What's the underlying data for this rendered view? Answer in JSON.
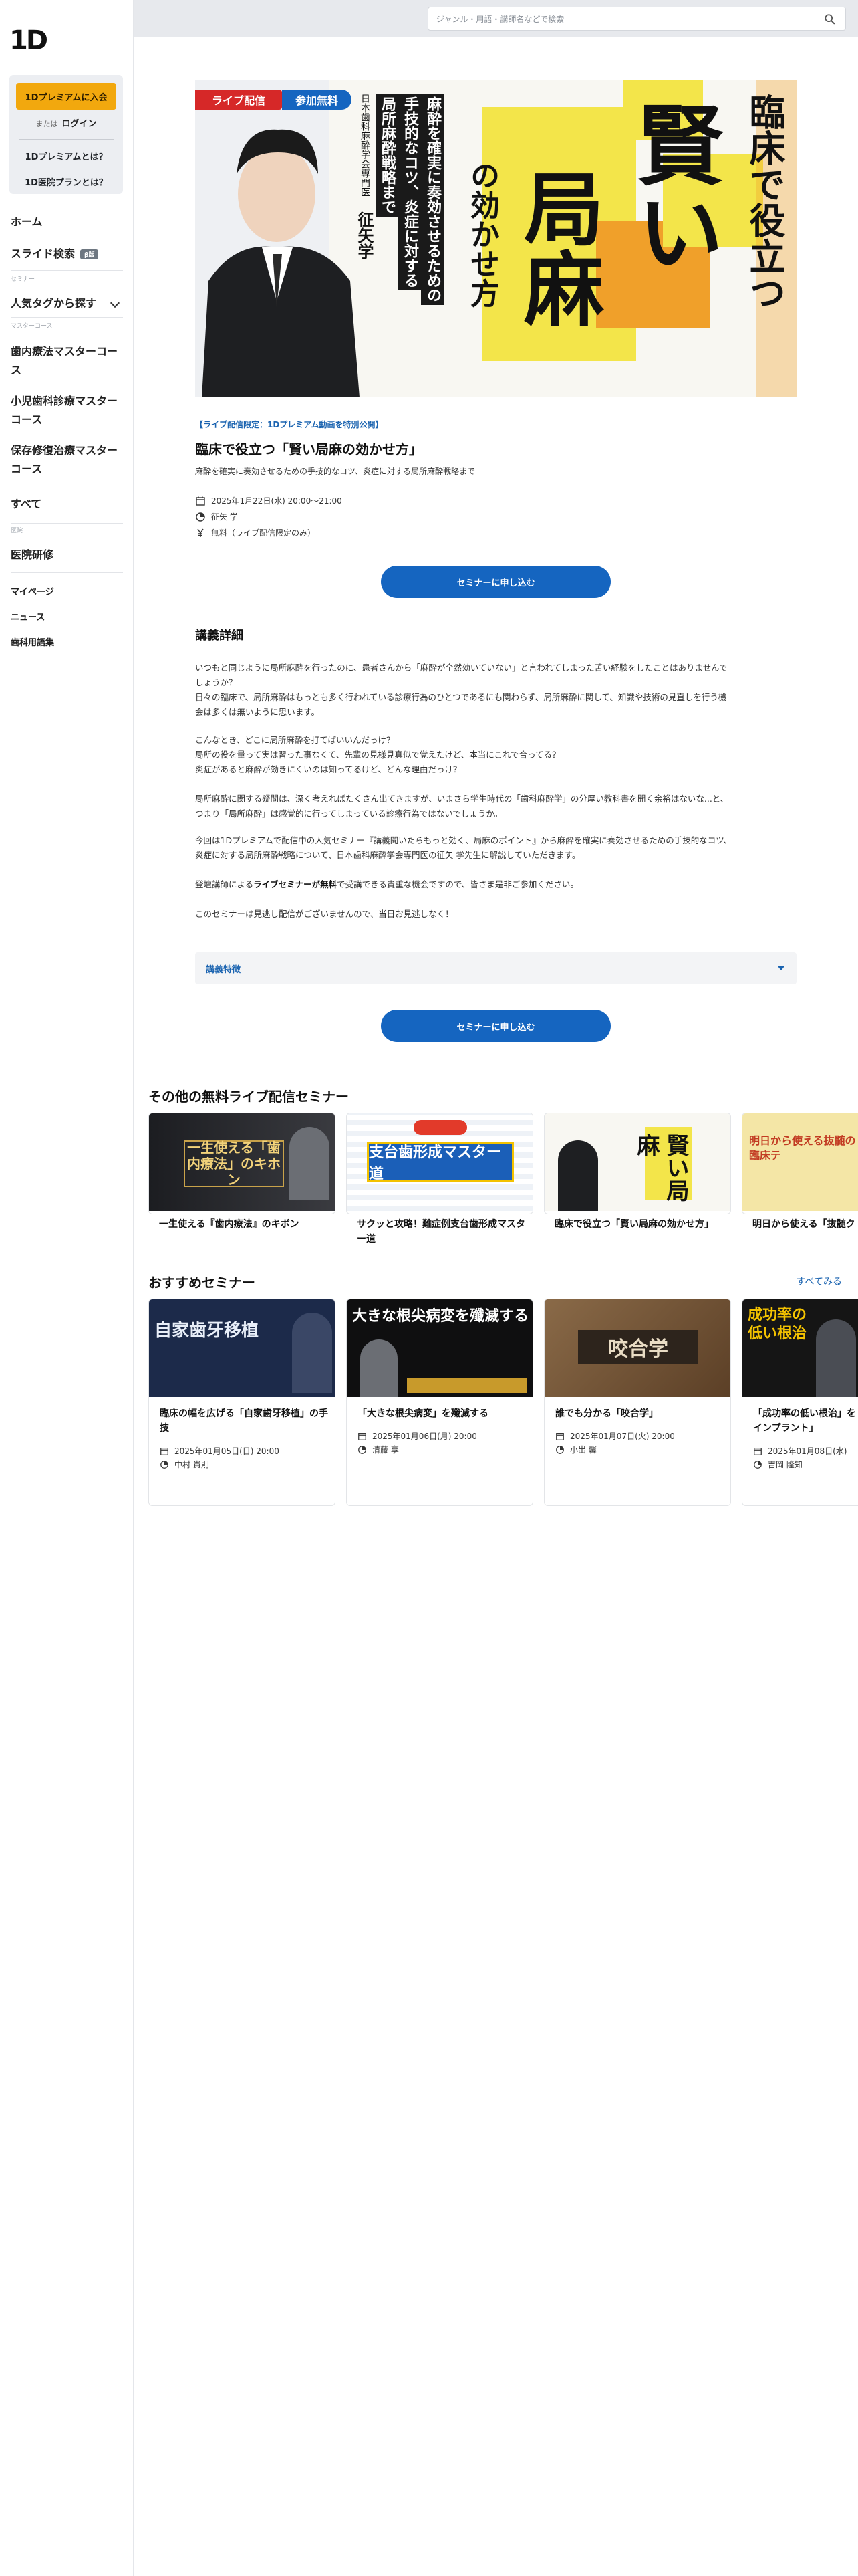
{
  "sidebar": {
    "logo": "1D",
    "join_button": "1Dプレミアムに入会",
    "or_text": "または",
    "login": "ログイン",
    "premium_about": "1Dプレミアムとは？",
    "clinic_plan": "1D医院プランとは？",
    "home": "ホーム",
    "slide_search": "スライド検索",
    "beta": "β版",
    "section_seminar": "セミナー",
    "popular_tags": "人気タグから探す",
    "section_master": "マスターコース",
    "master1": "歯内療法マスターコース",
    "master2": "小児歯科診療マスターコース",
    "master3": "保存修復治療マスターコース",
    "all": "すべて",
    "section_clinic": "医院",
    "clinic_training": "医院研修",
    "mypage": "マイページ",
    "news": "ニュース",
    "glossary": "歯科用語集"
  },
  "search": {
    "placeholder": "ジャンル・用語・講師名などで検索"
  },
  "hero": {
    "live_badge": "ライブ配信",
    "free_badge": "参加無料",
    "catch1": "麻酔を確実に奏効させるための",
    "catch2": "手技的なコツ、炎症に対する",
    "catch3": "局所麻酔戦略まで",
    "org": "日本歯科麻酔学会専門医",
    "lecturer": "征矢学",
    "big1": "臨床で役立つ",
    "big2": "賢い",
    "big3": "局麻",
    "big4": "の効かせ方"
  },
  "seminar": {
    "tag": "【ライブ配信限定：1Dプレミアム動画を特別公開】",
    "title": "臨床で役立つ「賢い局麻の効かせ方」",
    "subtitle": "麻酔を確実に奏効させるための手技的なコツ、炎症に対する局所麻酔戦略まで",
    "date": "2025年1月22日(水) 20:00〜21:00",
    "speaker": "征矢 学",
    "price": "無料（ライブ配信限定のみ）",
    "apply": "セミナーに申し込む"
  },
  "details": {
    "heading": "講義詳細",
    "p1a": "いつもと同じように局所麻酔を行ったのに、患者さんから「麻酔が全然効いていない」と言われてしまった苦い経験をしたことはありませんで",
    "p1b": "しょうか？",
    "p1c": "日々の臨床で、局所麻酔はもっとも多く行われている診療行為のひとつであるにも関わらず、局所麻酔に関して、知識や技術の見直しを行う機",
    "p1d": "会は多くは無いように思います。",
    "p2a": "こんなとき、どこに局所麻酔を打てばいいんだっけ？",
    "p2b": "局所の役を量って実は習った事なくて、先輩の見様見真似で覚えたけど、本当にこれで合ってる？",
    "p2c": "炎症があると麻酔が効きにくいのは知ってるけど、どんな理由だっけ？",
    "p3a": "局所麻酔に関する疑問は、深く考えればたくさん出てきますが、いまさら学生時代の「歯科麻酔学」の分厚い教科書を開く余裕はないな...と、",
    "p3b": "つまり「局所麻酔」は感覚的に行ってしまっている診療行為ではないでしょうか。",
    "p4a": "今回は1Dプレミアムで配信中の人気セミナー『講義聞いたらもっと効く、局麻のポイント』から麻酔を確実に奏効させるための手技的なコツ、",
    "p4b": "炎症に対する局所麻酔戦略について、日本歯科麻酔学会専門医の征矢 学先生に解説していただきます。",
    "p5_pre": "登壇講師による",
    "p5_bold": "ライブセミナーが無料",
    "p5_post": "で受講できる貴重な機会ですので、皆さま是非ご参加ください。",
    "p6": "このセミナーは見逃し配信がございませんので、当日お見逃しなく！",
    "features": "講義特徴"
  },
  "free_live": {
    "heading": "その他の無料ライブ配信セミナー",
    "cards": [
      {
        "title": "一生使える『歯内療法』のキボン",
        "thumb": "一生使える「歯内療法」のキホン"
      },
      {
        "title": "サクッと攻略！難症例支台歯形成マスター道",
        "thumb": "支台歯形成マスター道"
      },
      {
        "title": "臨床で役立つ「賢い局麻の効かせ方」",
        "thumb": "賢い局麻"
      },
      {
        "title": "明日から使える「抜髄ク",
        "thumb": "明日から使える抜髄の臨床テ"
      }
    ]
  },
  "recommended": {
    "heading": "おすすめセミナー",
    "see_all": "すべてみる",
    "cards": [
      {
        "title": "臨床の幅を広げる「自家歯牙移植」の手技",
        "date": "2025年01月05日(日) 20:00",
        "speaker": "中村 貴則",
        "thumb": "自家歯牙移植"
      },
      {
        "title": "「大きな根尖病変」を殲滅する",
        "date": "2025年01月06日(月) 20:00",
        "speaker": "清藤 享",
        "thumb": "大きな根尖病変を殲滅する"
      },
      {
        "title": "誰でも分かる「咬合学」",
        "date": "2025年01月07日(火) 20:00",
        "speaker": "小出 馨",
        "thumb": "咬合学"
      },
      {
        "title": "「成功率の低い根治」をインプラント」",
        "date": "2025年01月08日(水)",
        "speaker": "吉岡 隆知",
        "thumb": "成功率の低い根治"
      }
    ]
  },
  "colors": {
    "accent": "#1565c0",
    "premium": "#f2a80e",
    "hero_yellow": "#f3e54a",
    "hero_orange": "#f0a02a"
  }
}
